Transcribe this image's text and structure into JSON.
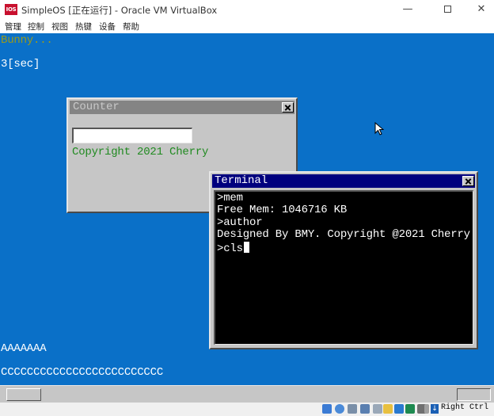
{
  "window": {
    "icon_text": "IOS",
    "title": "SimpleOS [正在运行] - Oracle VM VirtualBox",
    "minimize": "—",
    "close": "✕"
  },
  "menubar": {
    "items": [
      {
        "label": "管理"
      },
      {
        "label": "控制"
      },
      {
        "label": "视图"
      },
      {
        "label": "热键"
      },
      {
        "label": "设备"
      },
      {
        "label": "帮助"
      }
    ]
  },
  "guest": {
    "line1": "Bunny...",
    "line2": "3[sec]",
    "row_a": "AAAAAAA",
    "row_c": "CCCCCCCCCCCCCCCCCCCCCCCCC",
    "colors": {
      "desktop": "#0a70c8",
      "yellow_text": "#9a9a1c",
      "active_title": "#00007e",
      "inactive_title": "#848484",
      "green_text": "#208a20"
    }
  },
  "counter": {
    "title": "Counter",
    "input_value": "",
    "copyright": "Copyright 2021 Cherry"
  },
  "terminal": {
    "title": "Terminal",
    "lines": [
      ">mem",
      "Free Mem: 1046716 KB",
      ">author",
      "Designed By BMY. Copyright @2021 Cherry",
      ">cls"
    ]
  },
  "statusbar": {
    "host_key": "Right Ctrl",
    "icons": [
      "hard-disk-icon",
      "optical-drive-icon",
      "audio-icon",
      "network-icon",
      "usb-icon",
      "shared-folder-icon",
      "display-icon",
      "video-capture-icon",
      "cpu-icon",
      "mouse-integration-icon",
      "host-key-icon"
    ]
  }
}
